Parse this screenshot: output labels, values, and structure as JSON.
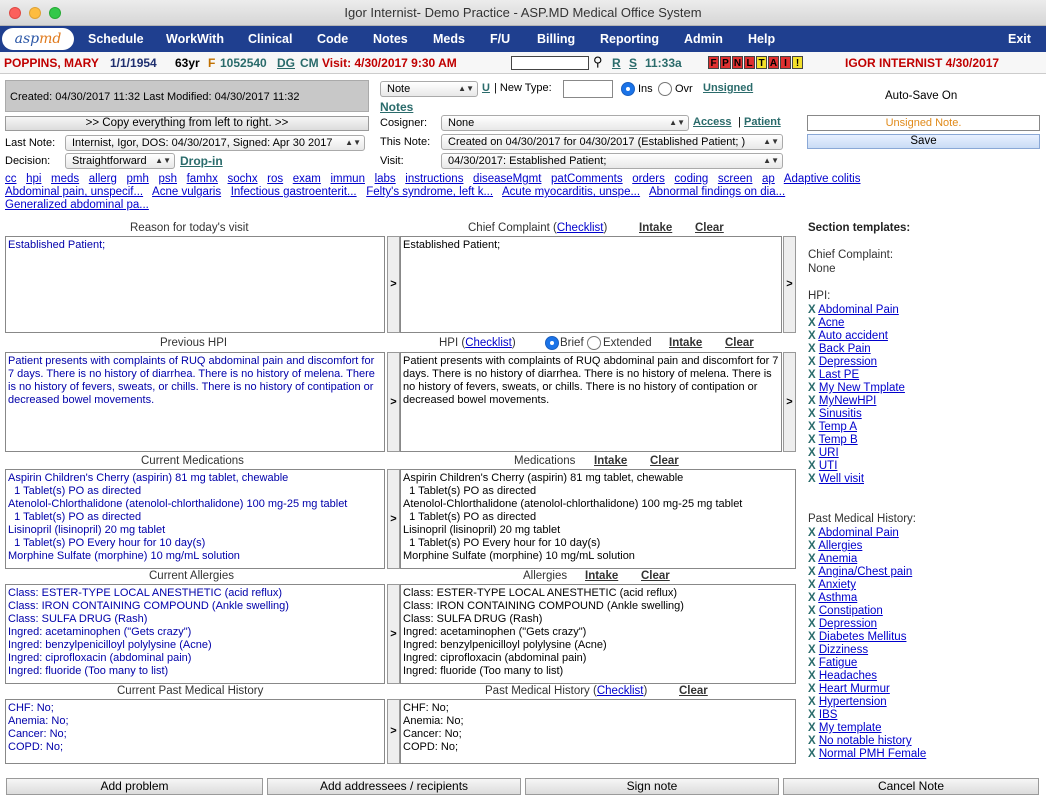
{
  "window": {
    "title": "Igor Internist- Demo Practice - ASP.MD Medical Office System"
  },
  "logo": {
    "text_a": "asp",
    "text_b": "md"
  },
  "menu": [
    "Schedule",
    "WorkWith",
    "Clinical",
    "Code",
    "Notes",
    "Meds",
    "F/U",
    "Billing",
    "Reporting",
    "Admin",
    "Help",
    "Exit"
  ],
  "patient": {
    "name": "POPPINS, MARY",
    "dob": "1/1/1954",
    "age": "63yr",
    "sex": "F",
    "id": "1052540",
    "dg": "DG",
    "cm": "CM",
    "visit": "Visit: 4/30/2017 9:30 AM",
    "time": "11:33a",
    "r": "R",
    "s": "S",
    "boxes": [
      "F",
      "P",
      "N",
      "L",
      "T",
      "A",
      "I",
      "!"
    ],
    "provider": "IGOR INTERNIST 4/30/2017"
  },
  "note_info": {
    "created": "Created: 04/30/2017 11:32   Last Modified: 04/30/2017 11:32",
    "copy_btn": ">> Copy everything from left to right. >>",
    "last_note_label": "Last Note:",
    "last_note_value": "Internist, Igor, DOS: 04/30/2017, Signed: Apr 30 2017",
    "decision_label": "Decision:",
    "decision_value": "Straightforward",
    "dropin": "Drop-in"
  },
  "note_form": {
    "type_value": "Note",
    "u": "U",
    "new_type_label": "| New Type:",
    "ins": "Ins",
    "ovr": "Ovr",
    "unsigned": "Unsigned",
    "notes": "Notes",
    "cosigner_label": "Cosigner:",
    "cosigner_value": "None",
    "access": "Access",
    "sep": "|",
    "patient": "Patient",
    "thisnote_label": "This Note:",
    "thisnote_value": "Created on 04/30/2017 for 04/30/2017 (Established Patient; )",
    "visit_label": "Visit:",
    "visit_value": "04/30/2017: Established Patient;"
  },
  "autosave": {
    "label": "Auto-Save On",
    "status": "Unsigned Note.",
    "save": "Save"
  },
  "quicklinks": [
    "cc",
    "hpi",
    "meds",
    "allerg",
    "pmh",
    "psh",
    "famhx",
    "sochx",
    "ros",
    "exam",
    "immun",
    "labs",
    "instructions",
    "diseaseMgmt",
    "patComments",
    "orders",
    "coding",
    "screen",
    "ap",
    "Adaptive colitis"
  ],
  "problems": [
    "Abdominal pain, unspecif...",
    "Acne vulgaris",
    "Infectious gastroenterit...",
    "Felty's syndrome, left k...",
    "Acute myocarditis, unspe...",
    "Abnormal findings on dia...",
    "Generalized abdominal pa..."
  ],
  "sections": {
    "reason": {
      "title": "Reason for today's visit",
      "text": "Established Patient;"
    },
    "cc": {
      "title": "Chief Complaint (",
      "checklist": "Checklist",
      "close": ")",
      "intake": "Intake",
      "clear": "Clear",
      "text": "Established Patient;"
    },
    "prev_hpi": {
      "title": "Previous HPI",
      "text": "Patient presents with complaints of RUQ abdominal pain and discomfort for 7 days. There is no history of diarrhea. There is no history of melena. There is no history of fevers, sweats, or chills. There is no history of contipation or decreased bowel movements."
    },
    "hpi": {
      "title": "HPI (",
      "checklist": "Checklist",
      "close": ")",
      "brief": "Brief",
      "extended": "Extended",
      "intake": "Intake",
      "clear": "Clear",
      "text": "Patient presents with complaints of RUQ abdominal pain and discomfort for 7 days. There is no history of diarrhea. There is no history of melena. There is no history of fevers, sweats, or chills. There is no history of contipation or decreased bowel movements."
    },
    "cur_meds": {
      "title": "Current Medications",
      "text": "Aspirin Children's Cherry (aspirin) 81 mg tablet, chewable\n  1 Tablet(s) PO as directed\nAtenolol-Chlorthalidone (atenolol-chlorthalidone) 100 mg-25 mg tablet\n  1 Tablet(s) PO as directed\nLisinopril (lisinopril) 20 mg tablet\n  1 Tablet(s) PO Every hour for 10 day(s)\nMorphine Sulfate (morphine) 10 mg/mL solution"
    },
    "meds": {
      "title": "Medications",
      "intake": "Intake",
      "clear": "Clear",
      "text": "Aspirin Children's Cherry (aspirin) 81 mg tablet, chewable\n  1 Tablet(s) PO as directed\nAtenolol-Chlorthalidone (atenolol-chlorthalidone) 100 mg-25 mg tablet\n  1 Tablet(s) PO as directed\nLisinopril (lisinopril) 20 mg tablet\n  1 Tablet(s) PO Every hour for 10 day(s)\nMorphine Sulfate (morphine) 10 mg/mL solution"
    },
    "cur_allergies": {
      "title": "Current Allergies",
      "text": "Class: ESTER-TYPE LOCAL ANESTHETIC (acid reflux)\nClass: IRON CONTAINING COMPOUND (Ankle swelling)\nClass: SULFA DRUG (Rash)\nIngred: acetaminophen (\"Gets crazy\")\nIngred: benzylpenicilloyl polylysine (Acne)\nIngred: ciprofloxacin (abdominal pain)\nIngred: fluoride (Too many to list)"
    },
    "allergies": {
      "title": "Allergies",
      "intake": "Intake",
      "clear": "Clear",
      "text": "Class: ESTER-TYPE LOCAL ANESTHETIC (acid reflux)\nClass: IRON CONTAINING COMPOUND (Ankle swelling)\nClass: SULFA DRUG (Rash)\nIngred: acetaminophen (\"Gets crazy\")\nIngred: benzylpenicilloyl polylysine (Acne)\nIngred: ciprofloxacin (abdominal pain)\nIngred: fluoride (Too many to list)"
    },
    "cur_pmh": {
      "title": "Current Past Medical History",
      "text": "CHF: No;\nAnemia: No;\nCancer: No;\nCOPD: No;"
    },
    "pmh": {
      "title": "Past Medical History (",
      "checklist": "Checklist",
      "close": ")",
      "clear": "Clear",
      "text": "CHF: No;\nAnemia: No;\nCancer: No;\nCOPD: No;"
    }
  },
  "copy_arrow": ">",
  "templates": {
    "title": "Section templates:",
    "cc_label": "Chief Complaint:",
    "cc_value": "None",
    "hpi_label": "HPI:",
    "x": "X",
    "hpi": [
      "Abdominal Pain",
      "Acne",
      "Auto accident",
      "Back Pain",
      "Depression",
      "Last PE",
      "My New Tmplate",
      "MyNewHPI",
      "Sinusitis",
      "Temp A",
      "Temp B",
      "URI",
      "UTI",
      "Well visit"
    ],
    "pmh_label": "Past Medical History:",
    "pmh": [
      "Abdominal Pain",
      "Allergies",
      "Anemia",
      "Angina/Chest pain",
      "Anxiety",
      "Asthma",
      "Constipation",
      "Depression",
      "Diabetes Mellitus",
      "Dizziness",
      "Fatigue",
      "Headaches",
      "Heart Murmur",
      "Hypertension",
      "IBS",
      "My template",
      "No notable history",
      "Normal PMH Female"
    ]
  },
  "bottom": {
    "add_problem": "Add problem",
    "add_addressees": "Add addressees / recipients",
    "sign": "Sign note",
    "cancel": "Cancel Note"
  }
}
